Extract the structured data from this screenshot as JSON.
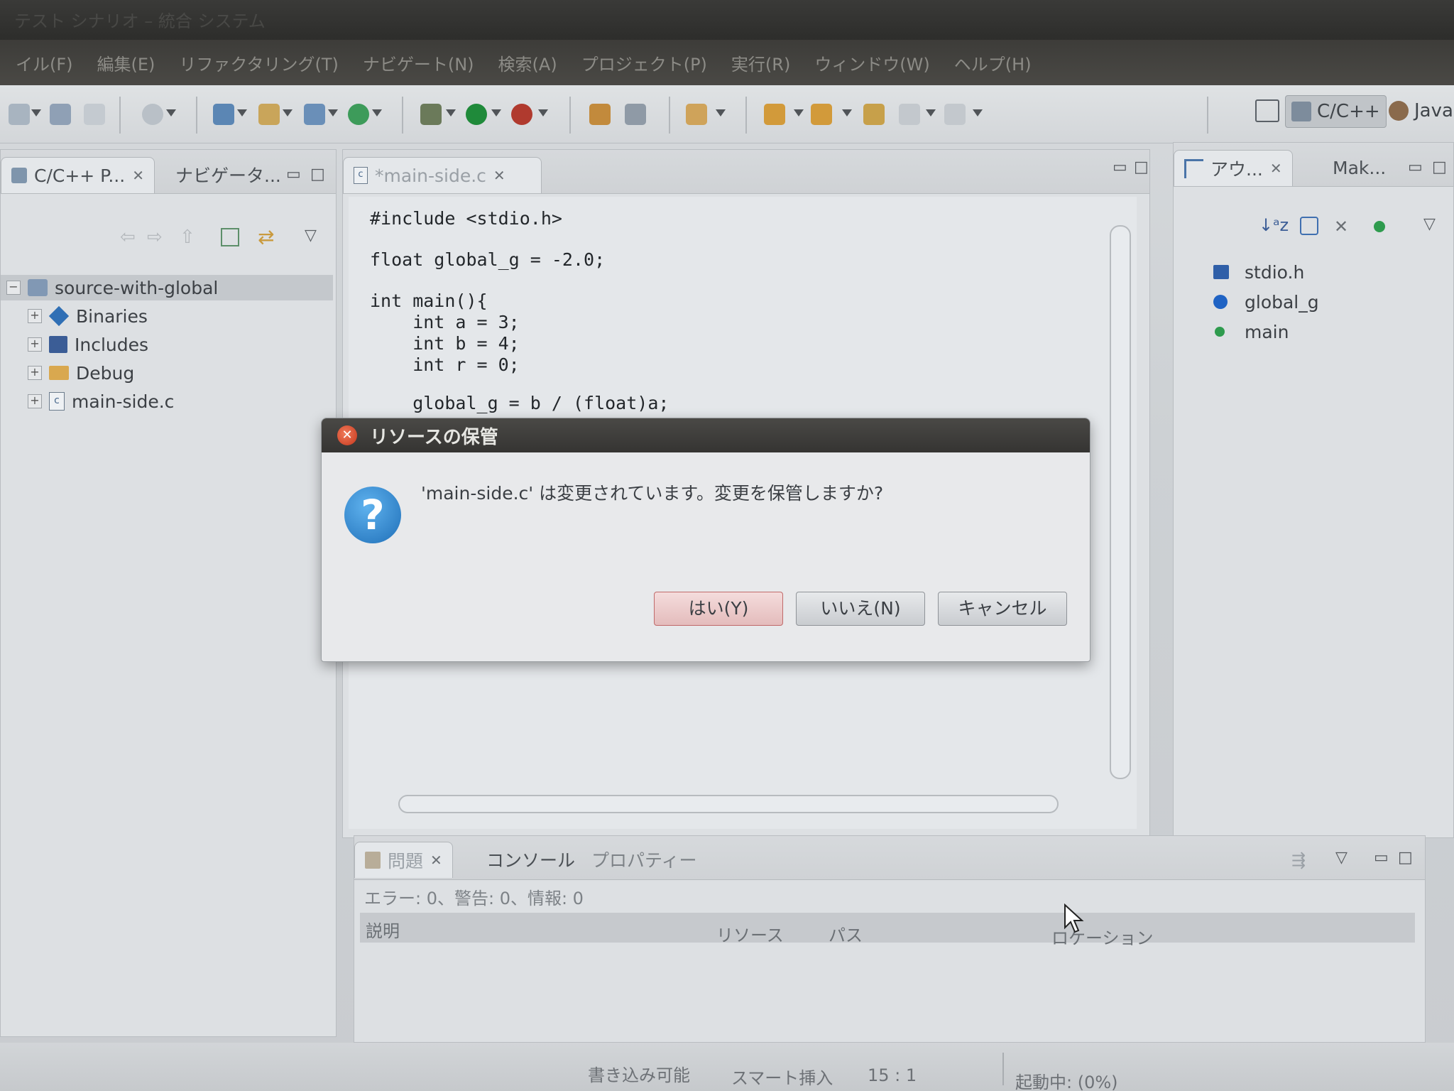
{
  "title_bar": {
    "text": "テスト シナリオ – 統合 システム"
  },
  "menu": [
    "イル(F)",
    "編集(E)",
    "リファクタリング(T)",
    "ナビゲート(N)",
    "検索(A)",
    "プロジェクト(P)",
    "実行(R)",
    "ウィンドウ(W)",
    "ヘルプ(H)"
  ],
  "perspectives": {
    "cpp": "C/C++",
    "java": "Java"
  },
  "project_panel": {
    "tab_label": "C/C++ P...",
    "tab2_label": "ナビゲータ...",
    "root": "source-with-global",
    "items": [
      {
        "label": "Binaries",
        "icon": "binaries-icon"
      },
      {
        "label": "Includes",
        "icon": "includes-icon"
      },
      {
        "label": "Debug",
        "icon": "folder-icon"
      },
      {
        "label": "main-side.c",
        "icon": "c-file-icon"
      }
    ]
  },
  "editor": {
    "tab_label": "*main-side.c",
    "code": [
      "#include <stdio.h>",
      "",
      "float global_g = -2.0;",
      "",
      "int main(){",
      "    int a = 3;",
      "    int b = 4;",
      "    int r = 0;",
      "",
      "    global_g = b / (float)a;"
    ]
  },
  "outline_panel": {
    "tab_label": "アウ...",
    "tab2_label": "Mak...",
    "items": [
      {
        "label": "stdio.h",
        "icon": "include-icon"
      },
      {
        "label": "global_g",
        "icon": "variable-icon"
      },
      {
        "label": "main",
        "icon": "function-icon"
      }
    ]
  },
  "problems_panel": {
    "tabs": [
      "問題",
      "コンソール",
      "プロパティー"
    ],
    "summary": "エラー: 0、警告: 0、情報: 0",
    "columns": [
      "説明",
      "リソース",
      "パス",
      "ロケーション"
    ]
  },
  "dialog": {
    "title": "リソースの保管",
    "message": "'main-side.c' は変更されています。変更を保管しますか?",
    "buttons": {
      "yes": "はい(Y)",
      "no": "いいえ(N)",
      "cancel": "キャンセル"
    }
  },
  "status_bar": {
    "writable": "書き込み可能",
    "insert_mode": "スマート挿入",
    "position": "15 : 1",
    "progress": "起動中: (0%)"
  },
  "colors": {
    "dialog_title_bg": "#353432",
    "question_icon": "#1f6fb8",
    "default_button_tint": "#e4bcbc"
  }
}
